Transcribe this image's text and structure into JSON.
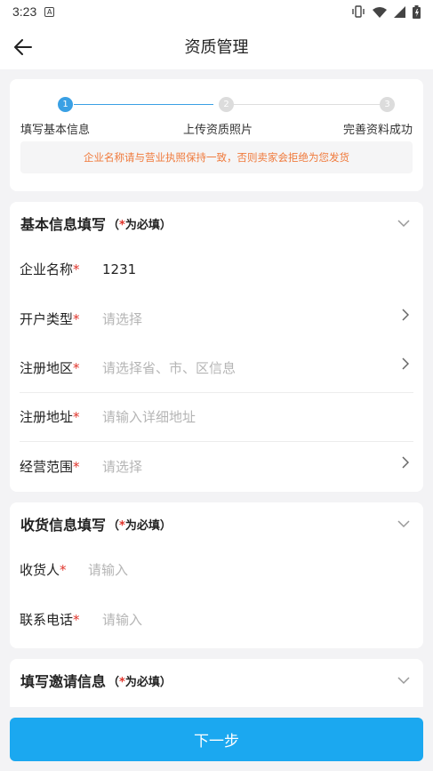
{
  "status_bar": {
    "time": "3:23",
    "notif_badge": "A"
  },
  "nav": {
    "title": "资质管理"
  },
  "steps": [
    {
      "num": "1",
      "label": "填写基本信息",
      "active": true
    },
    {
      "num": "2",
      "label": "上传资质照片",
      "active": false
    },
    {
      "num": "3",
      "label": "完善资料成功",
      "active": false
    }
  ],
  "notice": "企业名称请与营业执照保持一致，否则卖家会拒绝为您发货",
  "basic": {
    "title": "基本信息填写",
    "req_open": "（",
    "req_star": "*",
    "req_text": "为必填）",
    "fields": [
      {
        "label": "企业名称",
        "star": "*",
        "value": "1231",
        "placeholder": ""
      },
      {
        "label": "开户类型",
        "star": "*",
        "value": "",
        "placeholder": "请选择"
      },
      {
        "label": "注册地区",
        "star": "*",
        "value": "",
        "placeholder": "请选择省、市、区信息"
      },
      {
        "label": "注册地址",
        "star": "*",
        "value": "",
        "placeholder": "请输入详细地址"
      },
      {
        "label": "经营范围",
        "star": "*",
        "value": "",
        "placeholder": "请选择"
      }
    ]
  },
  "shipping": {
    "title": "收货信息填写",
    "req_open": "（",
    "req_star": "*",
    "req_text": "为必填）",
    "fields": [
      {
        "label": "收货人",
        "star": "*",
        "placeholder": "请输入"
      },
      {
        "label": "联系电话",
        "star": "*",
        "placeholder": "请输入"
      }
    ]
  },
  "invite": {
    "title": "填写邀请信息",
    "req_open": "（",
    "req_star": "*",
    "req_text": "为必填）"
  },
  "next_button": "下一步",
  "colors": {
    "accent": "#1ba8f0",
    "step_active": "#3aa0e4",
    "notice_text": "#f07a3c",
    "required_star": "#e0342b"
  }
}
